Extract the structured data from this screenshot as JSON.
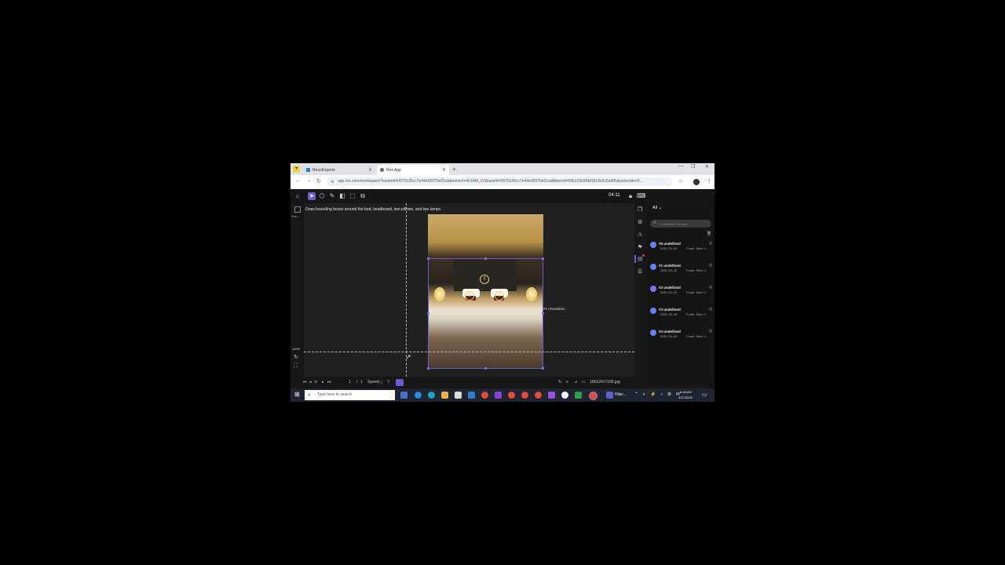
{
  "browser": {
    "tabs": [
      {
        "label": "RexoExperts",
        "active": false
      },
      {
        "label": "Rex App",
        "active": true
      }
    ],
    "url": "app.rex.zone/workspace?examId=0970126cc7e44e92070e01ab&version=EXAM_V2&taskId=0970126cc7e44e92070e01ad&itemId=69b133d14bf1910e2c5a455&selectIds=6..."
  },
  "toolbar": {
    "timer": "04:11"
  },
  "canvas": {
    "instruction": "Draw bounding boxes around the bed, headboard, two pillows, and two lamps.",
    "annotation_label": "#1 Annotation",
    "zoom": "100%",
    "left_label": "Ann..."
  },
  "panel": {
    "filter": "All",
    "search_placeholder": "Annotated Content",
    "items": [
      {
        "title": "#5 undefined",
        "date": "2026-03-16",
        "frame": "Frame Rate:1"
      },
      {
        "title": "#1 undefined",
        "date": "2026-03-16",
        "frame": "Frame Rate:1"
      },
      {
        "title": "#2 undefined",
        "date": "2026-03-16",
        "frame": "Frame Rate:1"
      },
      {
        "title": "#3 undefined",
        "date": "2026-03-16",
        "frame": "Frame Rate:1"
      },
      {
        "title": "#4 undefined",
        "date": "2026-03-16",
        "frame": "Frame Rate:1"
      }
    ]
  },
  "footer": {
    "page_current": "1",
    "page_sep": "/",
    "page_total": "1",
    "speed_label": "Speed",
    "filename": "10612417166.jpg"
  },
  "taskbar": {
    "search_placeholder": "Type here to search",
    "app_label": "Hilar...",
    "time": "6:08 AM",
    "date": "3/17/2026"
  },
  "colors": {
    "accent": "#6b5bd6",
    "item_dot": "#6c7ff0",
    "warning": "#e7cc6a"
  }
}
